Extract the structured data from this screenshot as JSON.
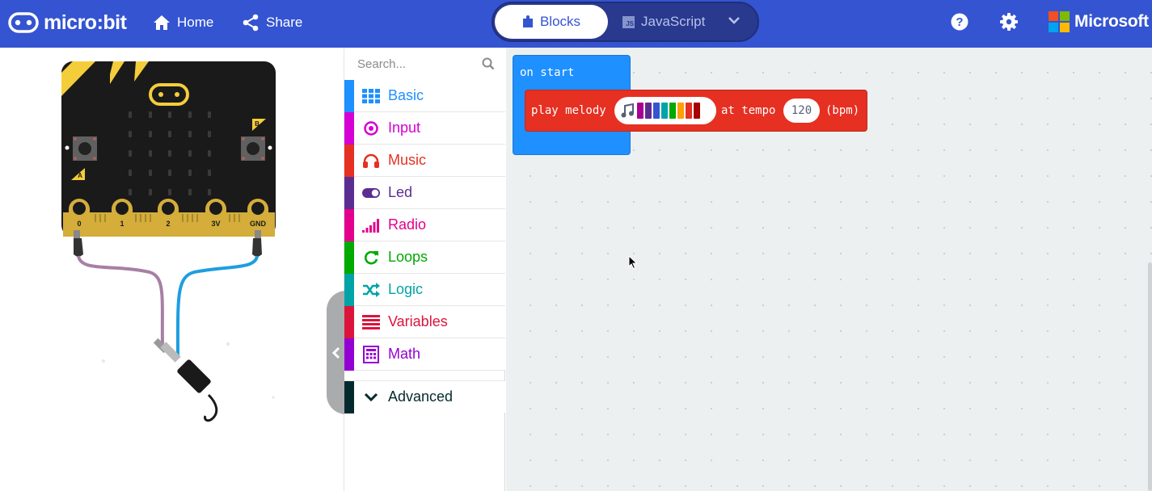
{
  "header": {
    "logo_text": "micro:bit",
    "home_label": "Home",
    "share_label": "Share",
    "blocks_label": "Blocks",
    "javascript_label": "JavaScript",
    "brand": "Microsoft",
    "brand_colors": [
      "#f25022",
      "#7fba00",
      "#00a4ef",
      "#ffb900"
    ],
    "bar_color": "#3454d1"
  },
  "simulator": {
    "pin_labels": [
      "0",
      "1",
      "2",
      "3V",
      "GND"
    ],
    "button_a": "A",
    "button_b": "B"
  },
  "toolbox": {
    "search_placeholder": "Search...",
    "categories": [
      {
        "label": "Basic",
        "color": "#1e90ff",
        "icon": "grid-icon"
      },
      {
        "label": "Input",
        "color": "#d400d4",
        "icon": "target-icon"
      },
      {
        "label": "Music",
        "color": "#e63022",
        "icon": "headphones-icon"
      },
      {
        "label": "Led",
        "color": "#5c2d91",
        "icon": "toggle-icon"
      },
      {
        "label": "Radio",
        "color": "#e3008c",
        "icon": "signal-bars-icon"
      },
      {
        "label": "Loops",
        "color": "#00aa00",
        "icon": "refresh-icon"
      },
      {
        "label": "Logic",
        "color": "#00a4a6",
        "icon": "shuffle-icon"
      },
      {
        "label": "Variables",
        "color": "#dc143c",
        "icon": "lines-icon"
      },
      {
        "label": "Math",
        "color": "#9400d3",
        "icon": "calculator-icon"
      }
    ],
    "advanced": {
      "label": "Advanced",
      "color": "#042a2d",
      "icon": "chevron-down-icon"
    }
  },
  "workspace": {
    "on_start_label": "on start",
    "play_melody_label": "play melody",
    "at_tempo_label": "at tempo",
    "tempo_value": "120",
    "bpm_label": "(bpm)",
    "melody_note_colors": [
      "#a80092",
      "#5c2d91",
      "#3454d1",
      "#00a4a6",
      "#00aa00",
      "#ff9f00",
      "#e63022",
      "#a80000"
    ]
  }
}
